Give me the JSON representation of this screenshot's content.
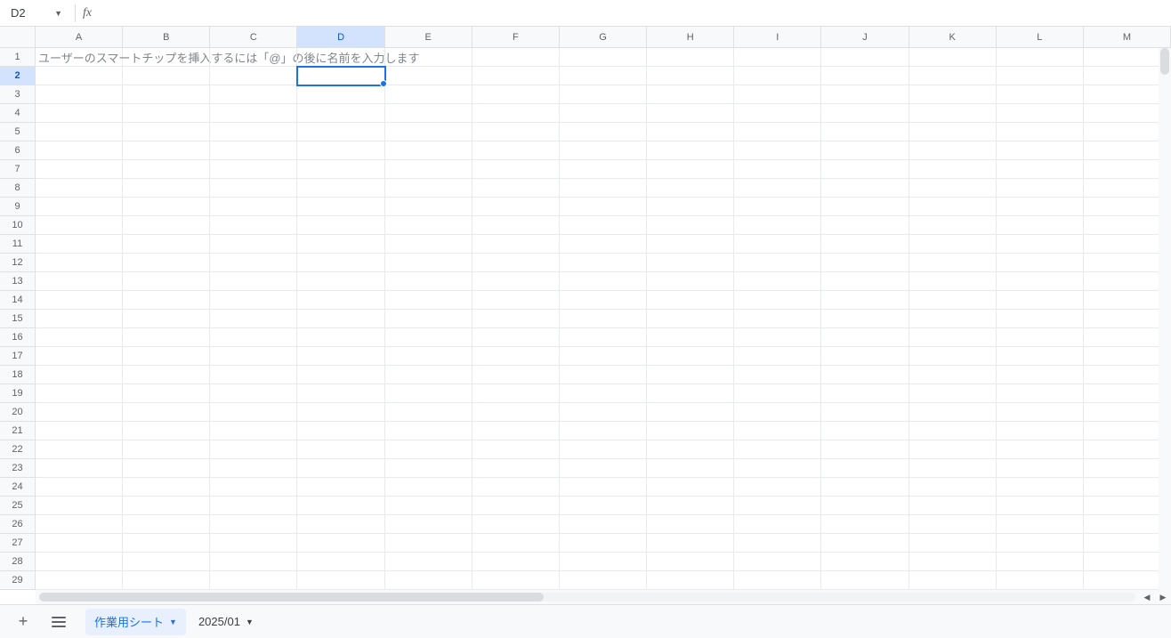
{
  "namebox": {
    "value": "D2"
  },
  "formula": {
    "fx_label": "fx",
    "value": ""
  },
  "columns": [
    "A",
    "B",
    "C",
    "D",
    "E",
    "F",
    "G",
    "H",
    "I",
    "J",
    "K",
    "L",
    "M"
  ],
  "rows": [
    "1",
    "2",
    "3",
    "4",
    "5",
    "6",
    "7",
    "8",
    "9",
    "10",
    "11",
    "12",
    "13",
    "14",
    "15",
    "16",
    "17",
    "18",
    "19",
    "20",
    "21",
    "22",
    "23",
    "24",
    "25",
    "26",
    "27",
    "28",
    "29"
  ],
  "active": {
    "col": "D",
    "row": "2"
  },
  "cells": {
    "A1": "ユーザーのスマートチップを挿入するには「@」の後に名前を入力します"
  },
  "tabbar": {
    "add_tooltip": "+",
    "tabs": [
      {
        "label": "作業用シート",
        "active": true
      },
      {
        "label": "2025/01",
        "active": false
      }
    ]
  }
}
